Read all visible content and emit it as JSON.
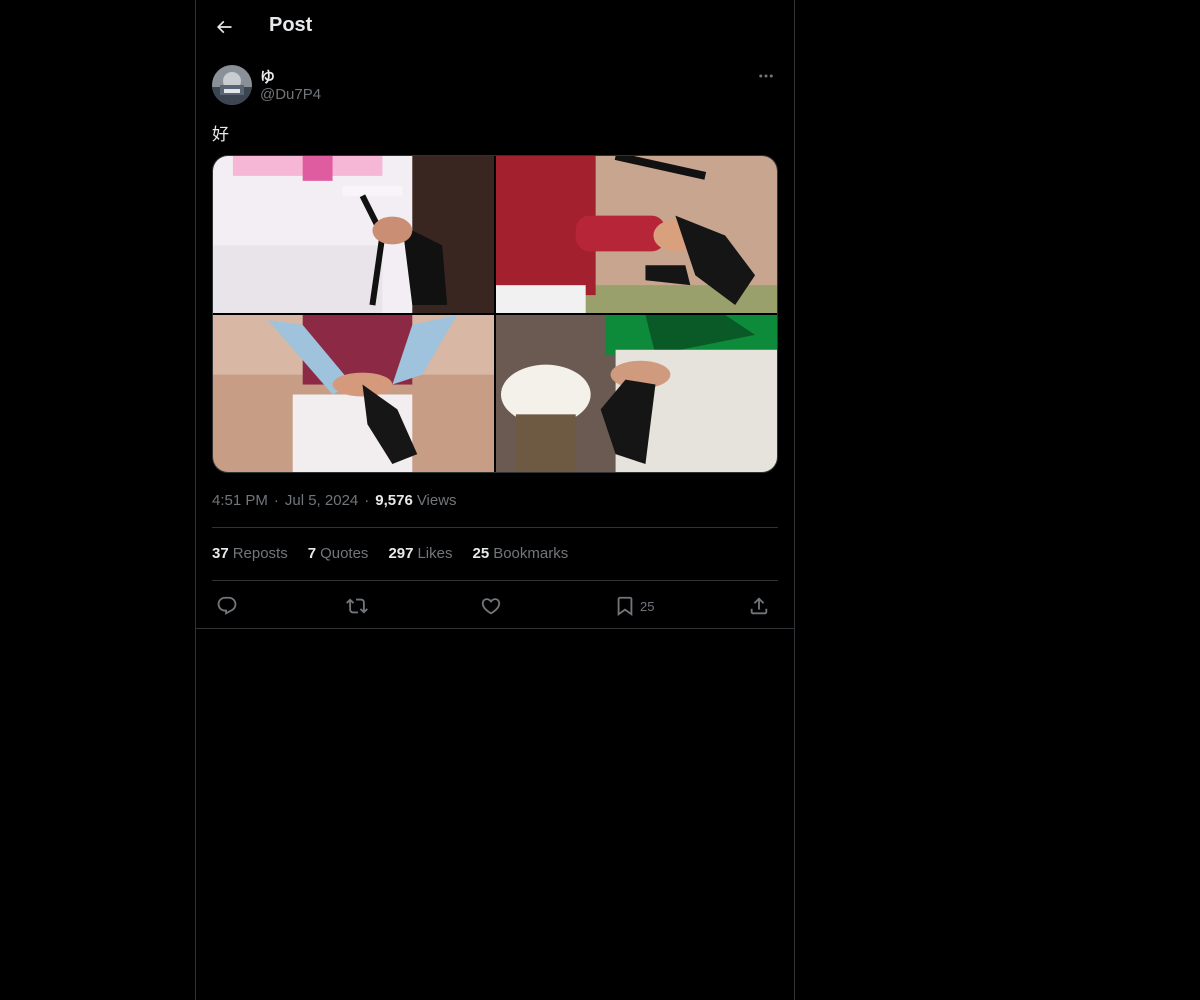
{
  "header": {
    "title": "Post",
    "back_icon": "arrow-left-icon"
  },
  "post": {
    "author": {
      "display_name": "ゆ",
      "handle": "@Du7P4"
    },
    "text": "好",
    "media": [
      {
        "description": "jockey in pink and white silks holding whip and gloves"
      },
      {
        "description": "jockey in red silks holding whip and black gloves"
      },
      {
        "description": "jockey in maroon silks with light blue sleeves putting on black gloves"
      },
      {
        "description": "jockey in green silks holding black gloves"
      }
    ],
    "time": "4:51 PM",
    "date": "Jul 5, 2024",
    "views_count": "9,576",
    "views_label": "Views",
    "separator": "·"
  },
  "stats": {
    "reposts": {
      "num": "37",
      "label": "Reposts"
    },
    "quotes": {
      "num": "7",
      "label": "Quotes"
    },
    "likes": {
      "num": "297",
      "label": "Likes"
    },
    "bookmarks": {
      "num": "25",
      "label": "Bookmarks"
    }
  },
  "actions": {
    "reply_icon": "reply-icon",
    "repost_icon": "repost-icon",
    "like_icon": "heart-icon",
    "bookmark_icon": "bookmark-icon",
    "bookmark_count": "25",
    "share_icon": "share-icon"
  },
  "colors": {
    "background": "#000000",
    "text_primary": "#e7e9ea",
    "text_secondary": "#71767b",
    "border": "#2f3336"
  }
}
